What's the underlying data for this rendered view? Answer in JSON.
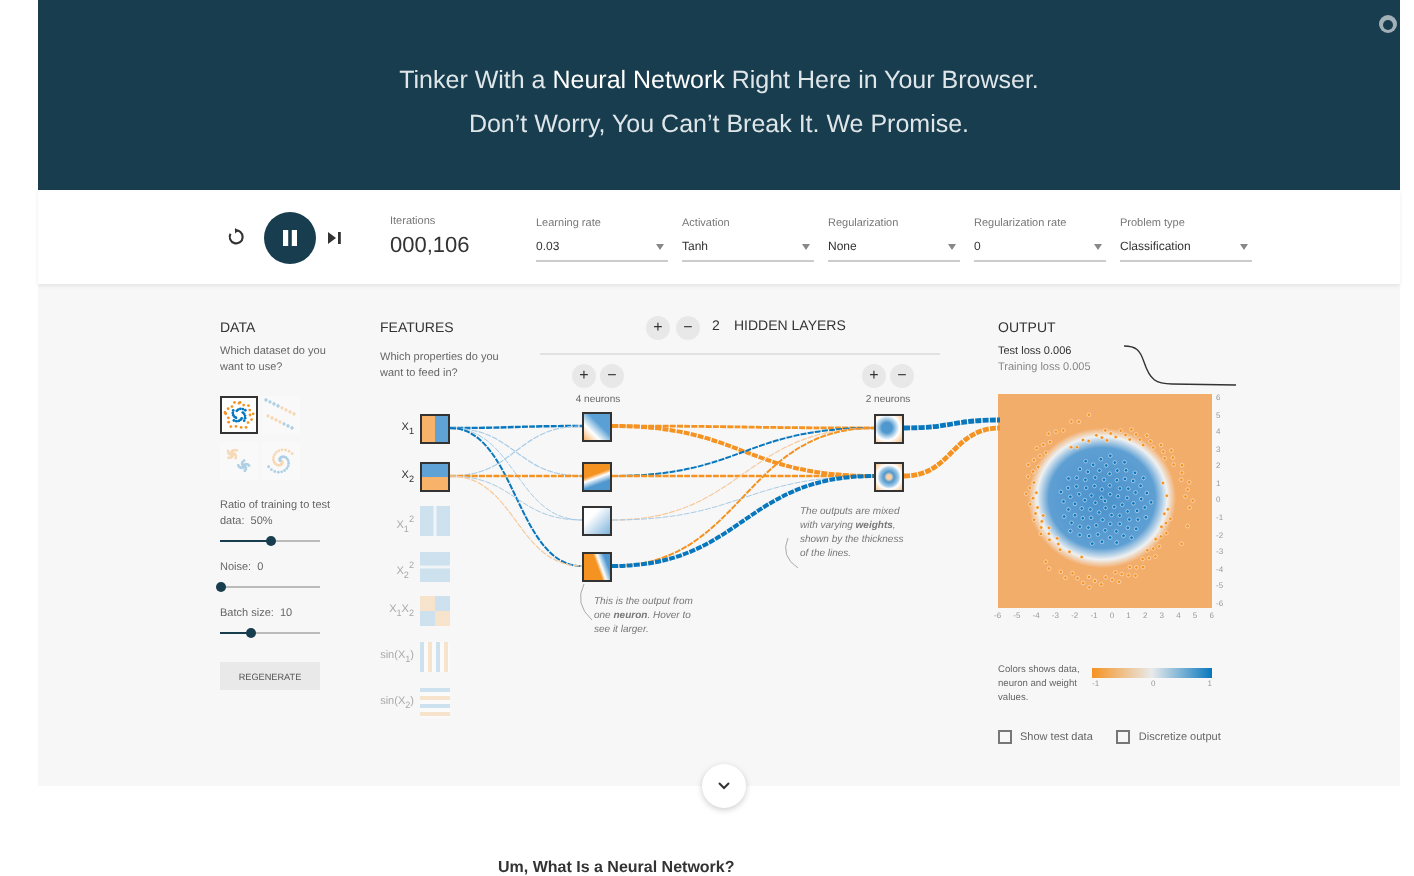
{
  "header": {
    "lines": [
      "Tinker With a **Neural Network** Right Here in Your Browser.",
      "Don’t Worry, You Can’t Break It. We Promise."
    ]
  },
  "controls": {
    "playing": true,
    "iterations": {
      "label": "Iterations",
      "value": "000,106"
    },
    "dropdowns": [
      {
        "label": "Learning rate",
        "value": "0.03"
      },
      {
        "label": "Activation",
        "value": "Tanh"
      },
      {
        "label": "Regularization",
        "value": "None"
      },
      {
        "label": "Regularization rate",
        "value": "0"
      },
      {
        "label": "Problem type",
        "value": "Classification"
      }
    ]
  },
  "data": {
    "title": "DATA",
    "question": "Which dataset do you want to use?",
    "datasets": [
      {
        "kind": "circle",
        "selected": true
      },
      {
        "kind": "xor",
        "selected": false
      },
      {
        "kind": "gauss",
        "selected": false
      },
      {
        "kind": "spiral",
        "selected": false
      }
    ],
    "sliders": [
      {
        "label": "Ratio of training to test data:",
        "value": "50%",
        "level": 0.5
      },
      {
        "label": "Noise:",
        "value": "0",
        "level": 0
      },
      {
        "label": "Batch size:",
        "value": "10",
        "level": 0.3
      }
    ],
    "button": "REGENERATE"
  },
  "features": {
    "title": "FEATURES",
    "question": "Which properties do you want to feed in?",
    "items": [
      {
        "label": "X$_{1}$",
        "kind": "vsplit",
        "on": true
      },
      {
        "label": "X$_{2}$",
        "kind": "hsplit",
        "on": true
      },
      {
        "label": "X$_{1}$$^{2}$",
        "kind": "vbands",
        "on": false
      },
      {
        "label": "X$_{2}$$^{2}$",
        "kind": "hbands",
        "on": false
      },
      {
        "label": "X$_{1}$X$_{2}$",
        "kind": "quadrants",
        "on": false
      },
      {
        "label": "sin(X$_{1}$)",
        "kind": "vstripes",
        "on": false
      },
      {
        "label": "sin(X$_{2}$)",
        "kind": "hstripes",
        "on": false
      }
    ]
  },
  "network": {
    "add": "+",
    "remove": "−",
    "count": "2",
    "title": "HIDDEN LAYERS",
    "layers": [
      {
        "add": "+",
        "remove": "−",
        "label": "4 neurons",
        "neurons": [
          {
            "kind": "corner"
          },
          {
            "kind": "tilted"
          },
          {
            "kind": "faint"
          },
          {
            "kind": "slant"
          }
        ]
      },
      {
        "add": "+",
        "remove": "−",
        "label": "2 neurons",
        "neurons": [
          {
            "kind": "blob"
          },
          {
            "kind": "ring"
          }
        ]
      }
    ],
    "notes": [
      "This is the output from one **neuron**. Hover to see it larger.",
      "The outputs are mixed with varying **weights**, shown by the thickness of the lines."
    ]
  },
  "output": {
    "title": "OUTPUT",
    "test_loss": "Test loss 0.006",
    "training_loss": "Training loss 0.005",
    "y_ticks": [
      "6",
      "5",
      "4",
      "3",
      "2",
      "1",
      "0",
      "-1",
      "-2",
      "-3",
      "-4",
      "-5",
      "-6"
    ],
    "x_ticks": [
      "-6",
      "-5",
      "-4",
      "-3",
      "-2",
      "-1",
      "0",
      "1",
      "2",
      "3",
      "4",
      "5",
      "6"
    ],
    "legend": {
      "text": "Colors shows data, neuron and weight values.",
      "ticks": [
        "-1",
        "0",
        "1"
      ]
    },
    "options": [
      {
        "label": "Show test data",
        "checked": false
      },
      {
        "label": "Discretize output",
        "checked": false
      }
    ]
  },
  "article": {
    "heading": "Um, What Is a Neural Network?"
  }
}
